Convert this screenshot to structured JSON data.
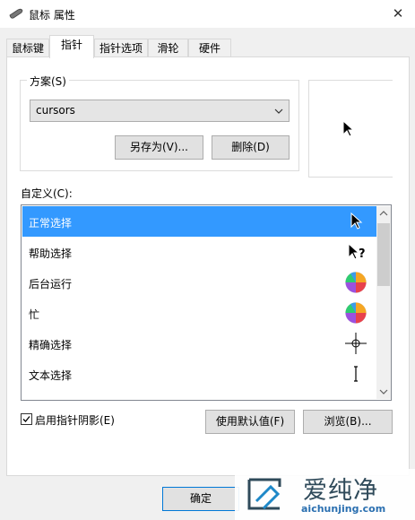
{
  "window": {
    "title": "鼠标 属性",
    "close_glyph": "✕"
  },
  "tabs": [
    {
      "label": "鼠标键"
    },
    {
      "label": "指针"
    },
    {
      "label": "指针选项"
    },
    {
      "label": "滑轮"
    },
    {
      "label": "硬件"
    }
  ],
  "active_tab": "指针",
  "scheme": {
    "group_label": "方案(S)",
    "selected": "cursors",
    "save_as_label": "另存为(V)...",
    "delete_label": "删除(D)"
  },
  "custom": {
    "label": "自定义(C):",
    "items": [
      {
        "label": "正常选择",
        "icon": "arrow-cursor-icon",
        "selected": true
      },
      {
        "label": "帮助选择",
        "icon": "help-cursor-icon",
        "selected": false
      },
      {
        "label": "后台运行",
        "icon": "busy-wheel-icon",
        "selected": false
      },
      {
        "label": "忙",
        "icon": "busy-wheel-icon",
        "selected": false
      },
      {
        "label": "精确选择",
        "icon": "crosshair-cursor-icon",
        "selected": false
      },
      {
        "label": "文本选择",
        "icon": "ibeam-cursor-icon",
        "selected": false
      }
    ]
  },
  "shadow_checkbox": {
    "label": "启用指针阴影(E)",
    "checked": true
  },
  "buttons": {
    "use_default": "使用默认值(F)",
    "browse": "浏览(B)...",
    "ok": "确定"
  },
  "watermark": {
    "text": "爱纯净",
    "url": "aichunjing.com"
  }
}
